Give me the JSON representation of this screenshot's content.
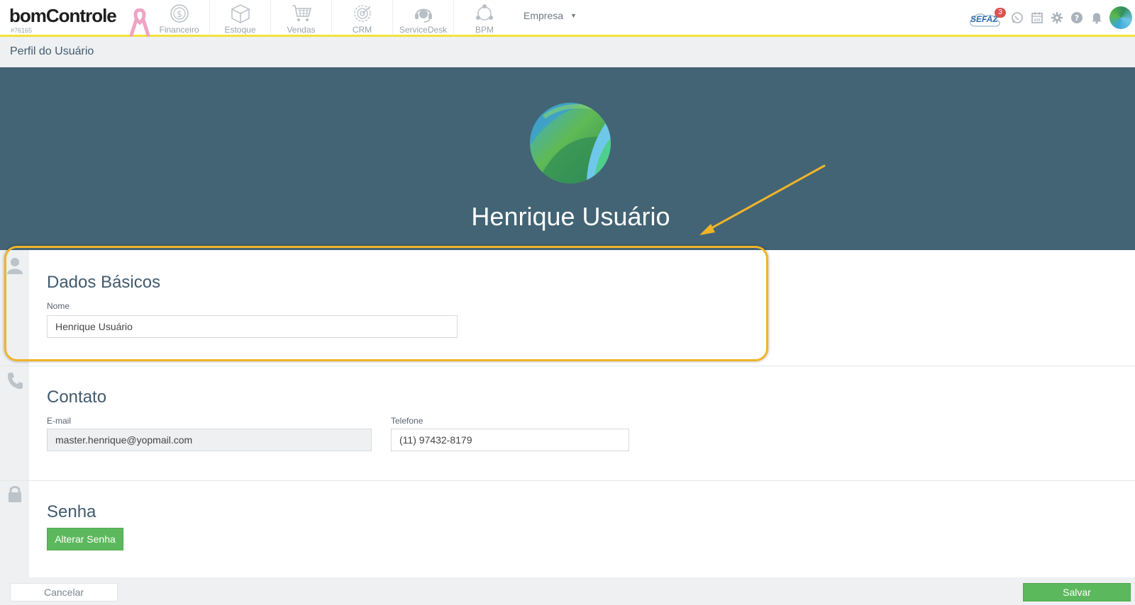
{
  "navbar": {
    "brand_name": "bomControle",
    "brand_id": "#76165",
    "modules": [
      {
        "label": "Financeiro",
        "icon": "dollar-coin-icon"
      },
      {
        "label": "Estoque",
        "icon": "box-icon"
      },
      {
        "label": "Vendas",
        "icon": "shopping-cart-icon"
      },
      {
        "label": "CRM",
        "icon": "target-icon"
      },
      {
        "label": "ServiceDesk",
        "icon": "headset-icon"
      },
      {
        "label": "BPM",
        "icon": "workflow-icon"
      }
    ],
    "empresa_label": "Empresa",
    "sefaz_label": "SEFAZ",
    "sefaz_badge": "3",
    "right_icons": [
      "whatsapp-icon",
      "calendar-icon",
      "gear-icon",
      "help-icon",
      "bell-icon"
    ]
  },
  "page": {
    "title": "Perfil do Usuário"
  },
  "profile": {
    "name": "Henrique Usuário"
  },
  "basic": {
    "title": "Dados Básicos",
    "name_label": "Nome",
    "name_value": "Henrique Usuário"
  },
  "contact": {
    "title": "Contato",
    "email_label": "E-mail",
    "email_value": "master.henrique@yopmail.com",
    "phone_label": "Telefone",
    "phone_value": "(11) 97432-8179"
  },
  "password": {
    "title": "Senha",
    "change_label": "Alterar Senha"
  },
  "footer": {
    "cancel_label": "Cancelar",
    "save_label": "Salvar"
  },
  "colors": {
    "hero": "#436474",
    "accent_yellow": "#f2e23a",
    "highlight": "#f0b429",
    "green_button": "#5cb85c",
    "title_text": "#415a6e"
  }
}
